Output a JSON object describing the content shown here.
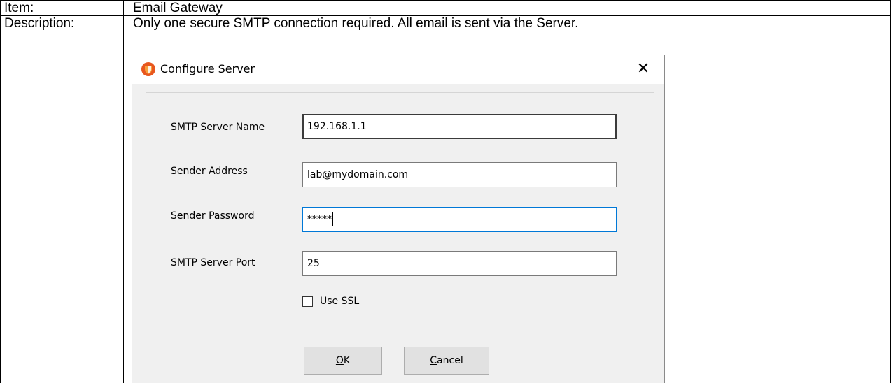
{
  "table": {
    "row1_label": "Item:",
    "row1_value": "Email Gateway",
    "row2_label": "Description:",
    "row2_value": "Only one secure SMTP connection required.  All email is sent via the Server."
  },
  "dialog": {
    "title": "Configure Server",
    "app_icon": "orange-shield-icon",
    "close_icon": "close-icon",
    "close_glyph": "✕",
    "fields": {
      "smtp_server_name": {
        "label": "SMTP Server Name",
        "value": "192.168.1.1"
      },
      "sender_address": {
        "label": "Sender Address",
        "value": "lab@mydomain.com"
      },
      "sender_password": {
        "label": "Sender Password",
        "value": "*****"
      },
      "smtp_server_port": {
        "label": "SMTP Server Port",
        "value": "25"
      }
    },
    "use_ssl": {
      "label": "Use SSL",
      "checked": false
    },
    "ok_button": {
      "mnemonic": "O",
      "rest": "K"
    },
    "cancel_button": {
      "mnemonic": "C",
      "rest": "ancel"
    }
  },
  "colors": {
    "dialog_bg": "#f0f0f0",
    "focus_border": "#0078d7",
    "button_bg": "#e1e1e1"
  }
}
